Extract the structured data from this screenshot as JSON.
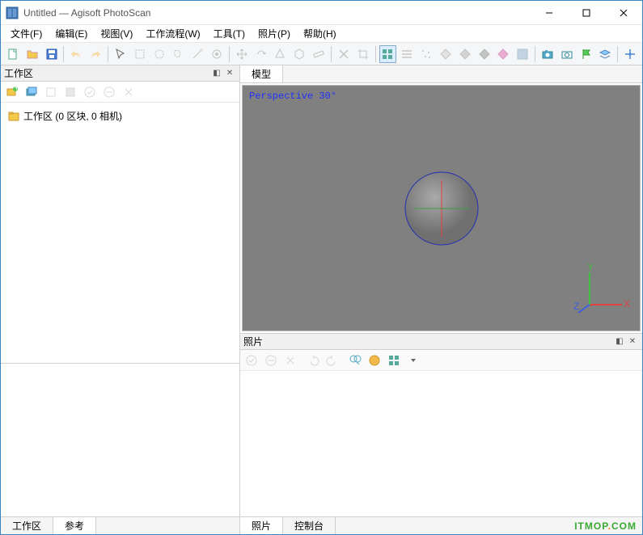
{
  "window": {
    "title": "Untitled — Agisoft PhotoScan"
  },
  "menu": {
    "file": "文件(F)",
    "edit": "编辑(E)",
    "view": "视图(V)",
    "workflow": "工作流程(W)",
    "tools": "工具(T)",
    "photo": "照片(P)",
    "help": "帮助(H)"
  },
  "panels": {
    "workspace_title": "工作区",
    "model_tab": "模型",
    "photos_title": "照片",
    "console_tab": "控制台",
    "workspace_tab": "工作区",
    "reference_tab": "参考"
  },
  "workspace": {
    "root_label": "工作区 (0 区块, 0 相机)"
  },
  "viewport": {
    "perspective_label": "Perspective 30°",
    "axis_x": "X",
    "axis_y": "Y",
    "axis_z": "Z"
  },
  "watermark": {
    "text1": "ITMOP",
    "dot": ".",
    "text2": "COM"
  }
}
